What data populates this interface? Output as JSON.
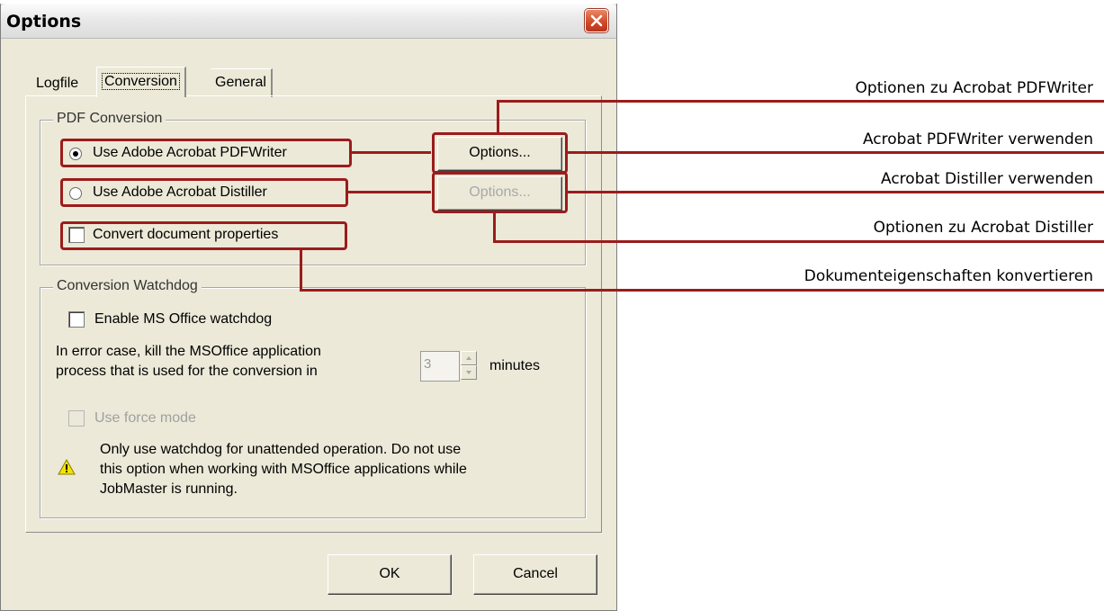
{
  "dialog": {
    "title": "Options",
    "tabs": [
      {
        "label": "Logfile",
        "active": false
      },
      {
        "label": "Conversion",
        "active": true
      },
      {
        "label": "General",
        "active": false
      }
    ],
    "pdf_conversion": {
      "group_title": "PDF Conversion",
      "radio_pdfwriter": "Use Adobe Acrobat PDFWriter",
      "radio_distiller": "Use Adobe Acrobat Distiller",
      "options_button": "Options...",
      "options_button_disabled": "Options...",
      "convert_properties": "Convert document properties",
      "selected": "pdfwriter"
    },
    "watchdog": {
      "group_title": "Conversion Watchdog",
      "enable_label": "Enable MS Office watchdog",
      "kill_text_line1": "In error case, kill the MSOffice application",
      "kill_text_line2": "process that is used for the conversion in",
      "minutes_value": "3",
      "minutes_label": "minutes",
      "force_mode_label": "Use force mode",
      "warning_line1": "Only use watchdog for unattended operation. Do not use",
      "warning_line2": "this option when working with MSOffice applications while",
      "warning_line3": "JobMaster is running."
    },
    "ok_button": "OK",
    "cancel_button": "Cancel"
  },
  "callouts": {
    "pdfwriter_options": "Optionen zu Acrobat PDFWriter",
    "pdfwriter_use": "Acrobat PDFWriter verwenden",
    "distiller_use": "Acrobat Distiller verwenden",
    "distiller_options": "Optionen zu Acrobat Distiller",
    "doc_properties": "Dokumenteigenschaften konvertieren"
  },
  "colors": {
    "highlight": "#9b1c1c",
    "dialog_bg": "#ece9d8",
    "close_button": "#d04726"
  }
}
